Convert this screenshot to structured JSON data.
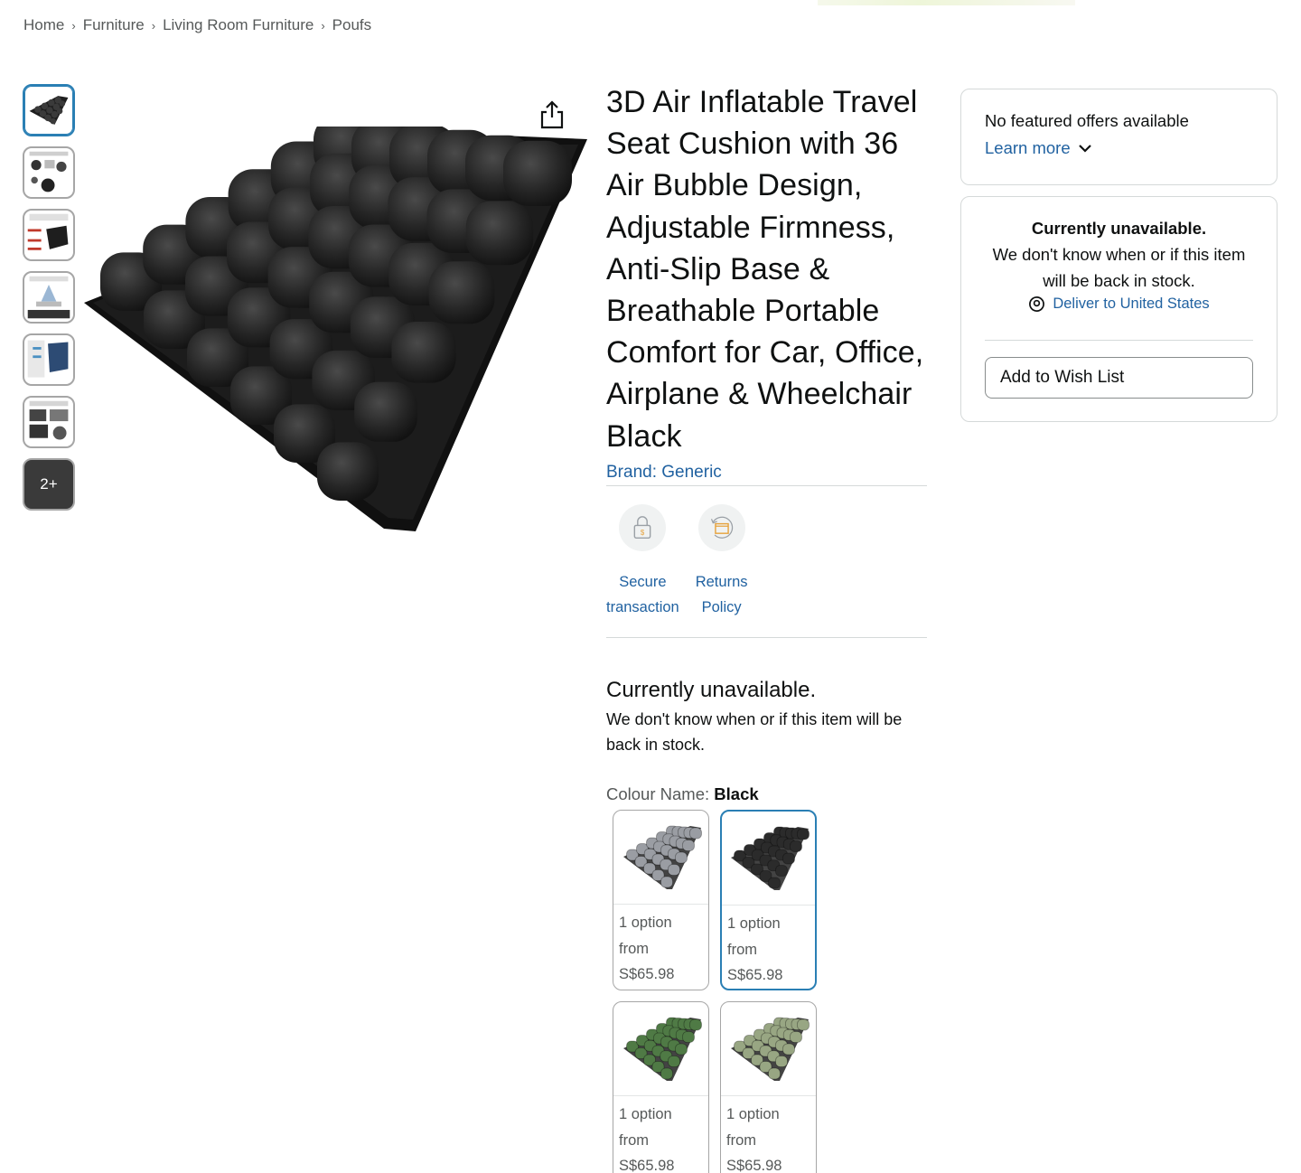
{
  "breadcrumb": {
    "items": [
      "Home",
      "Furniture",
      "Living Room Furniture",
      "Poufs"
    ],
    "separator": "›"
  },
  "thumbnails": {
    "more_label": "2+"
  },
  "product": {
    "title": "3D Air Inflatable Travel Seat Cushion with 36 Air Bubble Design, Adjustable Firmness, Anti-Slip Base & Breathable Portable Comfort for Car, Office, Airplane & Wheelchair Black",
    "brand": "Brand: Generic"
  },
  "badges": {
    "secure": [
      "Secure",
      "transaction"
    ],
    "returns": [
      "Returns",
      "Policy"
    ]
  },
  "availability": {
    "title": "Currently unavailable.",
    "text": "We don't know when or if this item will be back in stock."
  },
  "colour": {
    "label": "Colour Name:",
    "selected": "Black",
    "swatches": [
      {
        "line1": "1 option",
        "line2": "from",
        "price": "S$65.98",
        "color": "#9a9da3"
      },
      {
        "line1": "1 option",
        "line2": "from",
        "price": "S$65.98",
        "color": "#2b2b2b"
      },
      {
        "line1": "1 option",
        "line2": "from",
        "price": "S$65.98",
        "color": "#4f7a45"
      },
      {
        "line1": "1 option",
        "line2": "from",
        "price": "S$65.98",
        "color": "#98a683"
      }
    ]
  },
  "buybox": {
    "no_offers": "No featured offers available",
    "learn_more": "Learn more",
    "unavailable_title": "Currently unavailable.",
    "unavailable_text": "We don't know when or if this item will be back in stock.",
    "deliver": "Deliver to United States",
    "wish_list": "Add to Wish List"
  },
  "colors": {
    "link": "#2162a1",
    "selected_border": "#2a7fb4"
  }
}
